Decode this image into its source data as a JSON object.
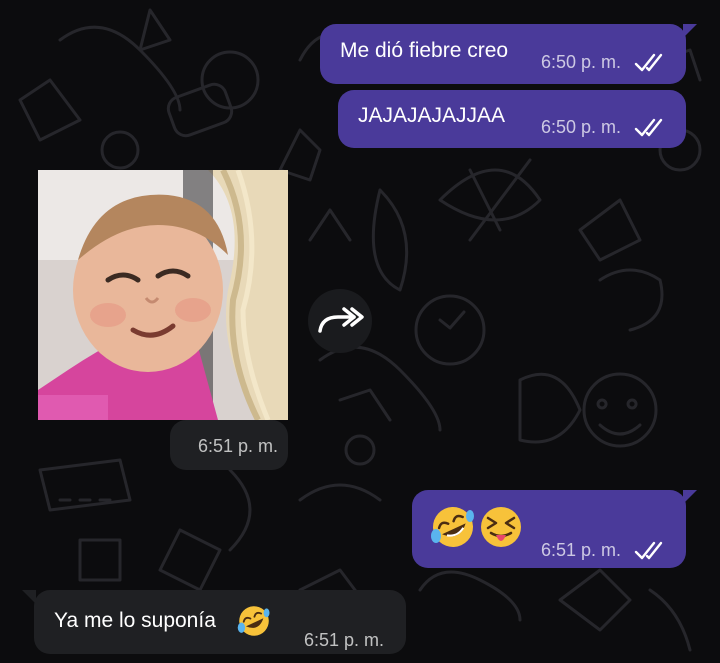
{
  "messages": [
    {
      "direction": "outgoing",
      "text": "Me dió fiebre creo",
      "time": "6:50 p. m.",
      "status": "read"
    },
    {
      "direction": "outgoing",
      "text": "JAJAJAJAJJAA",
      "time": "6:50 p. m.",
      "status": "read"
    },
    {
      "direction": "incoming",
      "type": "sticker",
      "sticker": "toddler-squinting-face",
      "time": "6:51 p. m."
    },
    {
      "direction": "outgoing",
      "type": "emoji",
      "emojis": [
        "rolling-on-floor-laughing",
        "squinting-face-with-tongue"
      ],
      "time": "6:51 p. m.",
      "status": "read"
    },
    {
      "direction": "incoming",
      "text": "Ya me lo suponía",
      "emoji": "rolling-on-floor-laughing",
      "time": "6:51 p. m."
    }
  ],
  "icons": {
    "forward": "forward-icon",
    "read_receipt": "double-check-icon"
  },
  "colors": {
    "outgoing_bubble": "#4a3a9a",
    "incoming_bubble": "#1f2023",
    "background": "#0c0c0e",
    "read_ticks": "#ffffff"
  }
}
